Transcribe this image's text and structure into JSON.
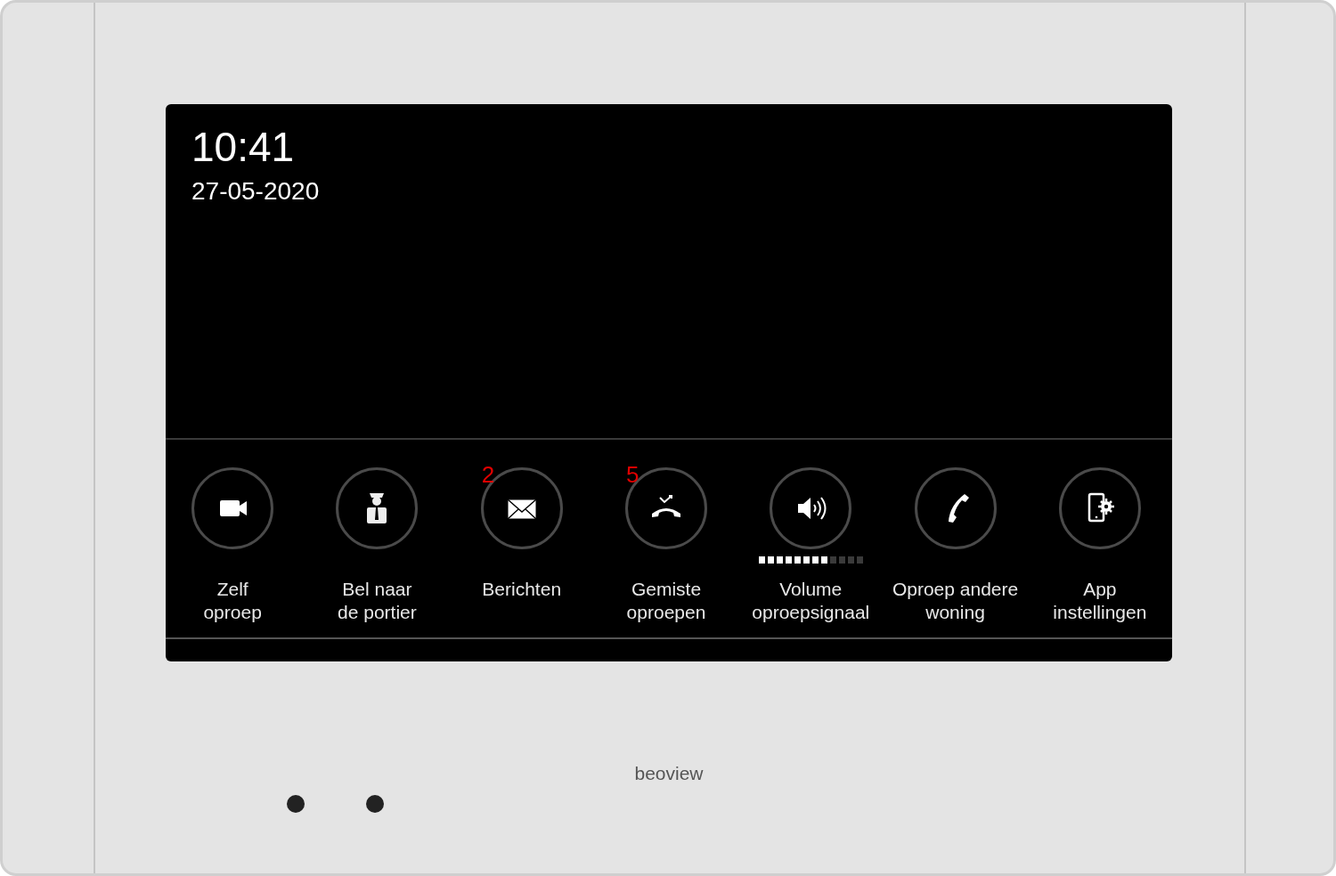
{
  "clock": {
    "time": "10:41",
    "date": "27-05-2020"
  },
  "buttons": [
    {
      "kind": "camera",
      "label_lines": [
        "Zelf",
        "oproep"
      ]
    },
    {
      "kind": "porter",
      "label_lines": [
        "Bel naar",
        "de portier"
      ]
    },
    {
      "kind": "envelope",
      "badge": "2",
      "label_lines": [
        "Berichten"
      ]
    },
    {
      "kind": "missed-call",
      "badge": "5",
      "label_lines": [
        "Gemiste",
        "oproepen"
      ]
    },
    {
      "kind": "speaker",
      "level": 0.667,
      "label_lines": [
        "Volume",
        "oproepsignaal"
      ]
    },
    {
      "kind": "phone",
      "label_lines": [
        "Oproep andere",
        "woning"
      ]
    },
    {
      "kind": "phone-gear",
      "label_lines": [
        "App",
        "instellingen"
      ]
    }
  ],
  "brand": "beoview"
}
